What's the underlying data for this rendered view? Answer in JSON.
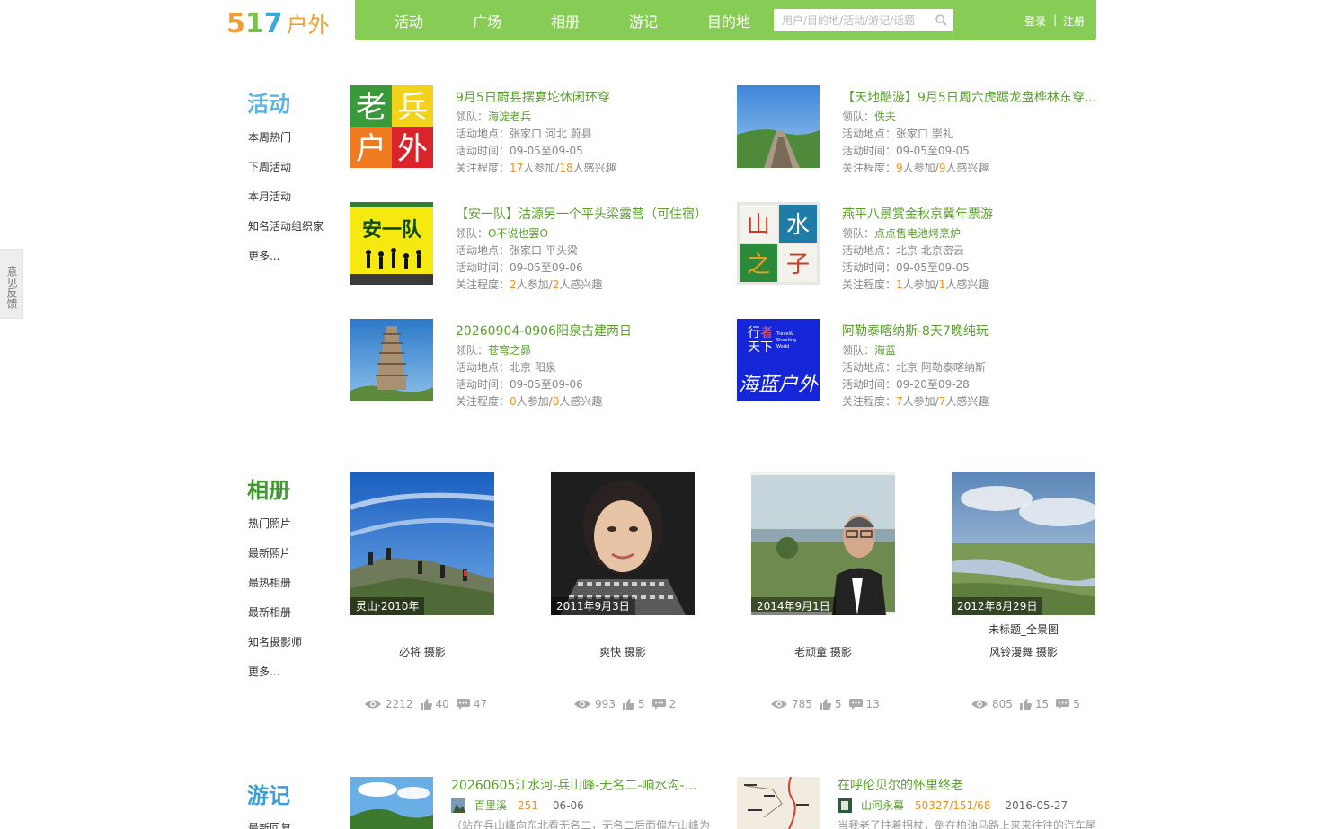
{
  "header": {
    "logo_number": "517",
    "logo_text": "户外",
    "nav": [
      "活动",
      "广场",
      "相册",
      "游记",
      "目的地"
    ],
    "search_placeholder": "用户/目的地/活动/游记/话题",
    "login": "登录",
    "separator": "|",
    "register": "注册"
  },
  "feedback": "意见反馈",
  "colors": {
    "accent_green": "#86cc55",
    "link_green": "#5aa12c",
    "highlight_orange": "#f09020",
    "activity_title_blue": "#5bb5e0",
    "album_title_green": "#3d9a2c",
    "travel_title_blue": "#3a9fd8"
  },
  "activities": {
    "title": "活动",
    "links": [
      "本周热门",
      "下周活动",
      "本月活动",
      "知名活动组织家",
      "更多..."
    ],
    "labels": {
      "leader": "领队：",
      "place": "活动地点：",
      "time": "活动时间：",
      "attention": "关注程度：",
      "joined": "人参加/",
      "interested": "人感兴趣"
    },
    "items": [
      {
        "title": "9月5日蔚县摆宴坨休闲环穿",
        "leader": "海淀老兵",
        "place": "张家口 河北 蔚县",
        "time": "09-05至09-05",
        "joined": "17",
        "interested": "18",
        "image": "laobing-huwai-logo"
      },
      {
        "title": "【天地酷游】9月5日周六虎踞龙盘桦林东穿...",
        "leader": "佚夫",
        "place": "张家口 崇礼",
        "time": "09-05至09-05",
        "joined": "9",
        "interested": "9",
        "image": "mountain-ridge-photo"
      },
      {
        "title": "【安一队】沽源另一个平头梁露营（可住宿）",
        "leader": "O不说也罢O",
        "place": "张家口 平头梁",
        "time": "09-05至09-06",
        "joined": "2",
        "interested": "2",
        "image": "anyidui-logo"
      },
      {
        "title": "燕平八景赏金秋京冀年票游",
        "leader": "点点售电池烤烹炉",
        "place": "北京 北京密云",
        "time": "09-05至09-05",
        "joined": "1",
        "interested": "1",
        "image": "shanshuizhizi-logo"
      },
      {
        "title": "20260904-0906阳泉古建两日",
        "leader": "苍穹之昴",
        "place": "北京 阳泉",
        "time": "09-05至09-06",
        "joined": "0",
        "interested": "0",
        "image": "pagoda-photo"
      },
      {
        "title": "阿勒泰喀纳斯-8天7晚纯玩",
        "leader": "海蓝",
        "place": "北京 阿勒泰喀纳斯",
        "time": "09-20至09-28",
        "joined": "7",
        "interested": "7",
        "image": "xingzhetianxia-logo"
      }
    ]
  },
  "album": {
    "title": "相册",
    "links": [
      "热门照片",
      "最新照片",
      "最热相册",
      "最新相册",
      "知名摄影师",
      "更多..."
    ],
    "photo_suffix": "摄影",
    "items": [
      {
        "date": "灵山·2010年",
        "name": "",
        "photographer": "必将",
        "views": "2212",
        "likes": "40",
        "comments": "47",
        "image": "hikers-sky-photo"
      },
      {
        "date": "2011年9月3日",
        "name": "",
        "photographer": "爽快",
        "views": "993",
        "likes": "5",
        "comments": "2",
        "image": "girl-portrait-photo"
      },
      {
        "date": "2014年9月1日",
        "name": "",
        "photographer": "老顽童",
        "views": "785",
        "likes": "5",
        "comments": "13",
        "image": "man-grassland-photo"
      },
      {
        "date": "2012年8月29日",
        "name": "未标题_全景图",
        "photographer": "风铃漫舞",
        "views": "805",
        "likes": "15",
        "comments": "5",
        "image": "river-panorama-photo"
      }
    ]
  },
  "travel_notes": {
    "title": "游记",
    "links": [
      "最新回复"
    ],
    "items": [
      {
        "title": "20260605江水河-兵山峰-无名二-响水沟-马...",
        "user": "百里溪",
        "counts": "251",
        "date": "06-06",
        "excerpt": "（站在兵山峰向东北看无名二，无名二后面偏左山峰为",
        "image": "green-mountain-photo"
      },
      {
        "title": "在呼伦贝尔的怀里终老",
        "user": "山河永幕",
        "counts": "50327/151/68",
        "date": "2016-05-27",
        "excerpt": "当我老了拄着拐杖，倒在柏油马路上来来往往的汽车尾",
        "image": "route-map-photo"
      }
    ]
  }
}
